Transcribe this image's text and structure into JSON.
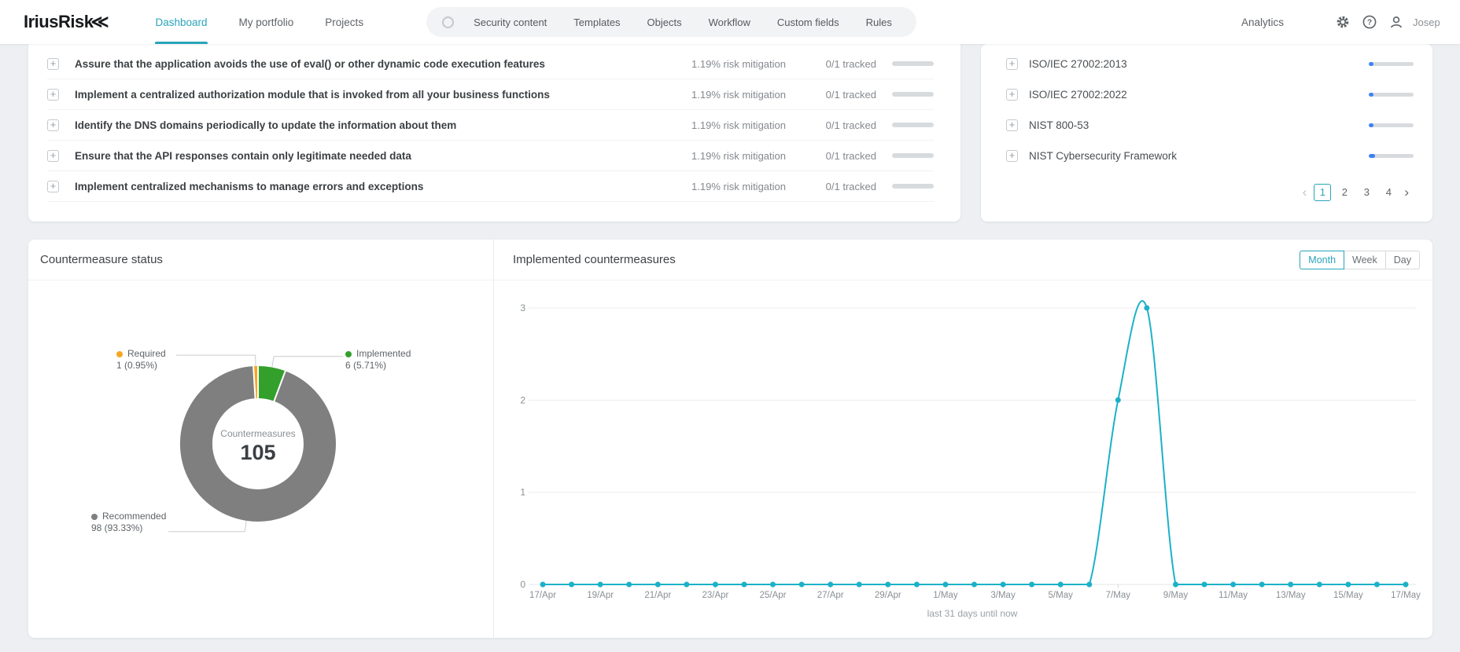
{
  "colors": {
    "accent": "#2aa4ba",
    "line": "#1cb1c8",
    "progress_blue": "#3b82f6",
    "progress_track": "#d8dbde"
  },
  "nav": {
    "logo": "IriusRisk",
    "tabs": [
      {
        "label": "Dashboard",
        "active": true
      },
      {
        "label": "My portfolio",
        "active": false
      },
      {
        "label": "Projects",
        "active": false
      }
    ],
    "pill": {
      "items": [
        "Security content",
        "Templates",
        "Objects",
        "Workflow",
        "Custom fields",
        "Rules"
      ]
    },
    "right": {
      "analytics_label": "Analytics",
      "username": "Josep"
    }
  },
  "countermeasures_panel": {
    "rows": [
      {
        "title": "Assure that the application avoids the use of eval() or other dynamic code execution features",
        "mitigation": "1.19% risk mitigation",
        "tracked": "0/1 tracked",
        "progress_pct": 0
      },
      {
        "title": "Implement a centralized authorization module that is invoked from all your business functions",
        "mitigation": "1.19% risk mitigation",
        "tracked": "0/1 tracked",
        "progress_pct": 0
      },
      {
        "title": "Identify the DNS domains periodically to update the information about them",
        "mitigation": "1.19% risk mitigation",
        "tracked": "0/1 tracked",
        "progress_pct": 0
      },
      {
        "title": "Ensure that the API responses contain only legitimate needed data",
        "mitigation": "1.19% risk mitigation",
        "tracked": "0/1 tracked",
        "progress_pct": 0
      },
      {
        "title": "Implement centralized mechanisms to manage errors and exceptions",
        "mitigation": "1.19% risk mitigation",
        "tracked": "0/1 tracked",
        "progress_pct": 0
      }
    ]
  },
  "standards_panel": {
    "rows": [
      {
        "title": "ISO/IEC 27002:2013",
        "progress_pct": 10
      },
      {
        "title": "ISO/IEC 27002:2022",
        "progress_pct": 10
      },
      {
        "title": "NIST 800-53",
        "progress_pct": 10
      },
      {
        "title": "NIST Cybersecurity Framework",
        "progress_pct": 14
      }
    ],
    "pagination": {
      "pages": [
        "1",
        "2",
        "3",
        "4"
      ],
      "active_page": "1"
    }
  },
  "status_panel": {
    "title": "Countermeasure status"
  },
  "implemented_panel": {
    "title": "Implemented countermeasures",
    "range_options": [
      {
        "label": "Month",
        "active": true
      },
      {
        "label": "Week",
        "active": false
      },
      {
        "label": "Day",
        "active": false
      }
    ]
  },
  "chart_data": [
    {
      "type": "pie",
      "title": "Countermeasure status",
      "donut": true,
      "center_label": "Countermeasures",
      "center_value": "105",
      "total": 105,
      "slices": [
        {
          "name": "Implemented",
          "value": 6,
          "pct": "5.71%",
          "label_line1": "Implemented",
          "label_line2": "6 (5.71%)",
          "color": "#33a02c"
        },
        {
          "name": "Recommended",
          "value": 98,
          "pct": "93.33%",
          "label_line1": "Recommended",
          "label_line2": "98 (93.33%)",
          "color": "#7f7f7f"
        },
        {
          "name": "Required",
          "value": 1,
          "pct": "0.95%",
          "label_line1": "Required",
          "label_line2": "1 (0.95%)",
          "color": "#f5a623"
        }
      ]
    },
    {
      "type": "line",
      "series_name": "Implemented countermeasures",
      "smooth": true,
      "color": "#1cb1c8",
      "x": [
        "17/Apr",
        "18/Apr",
        "19/Apr",
        "20/Apr",
        "21/Apr",
        "22/Apr",
        "23/Apr",
        "24/Apr",
        "25/Apr",
        "26/Apr",
        "27/Apr",
        "28/Apr",
        "29/Apr",
        "30/Apr",
        "1/May",
        "2/May",
        "3/May",
        "4/May",
        "5/May",
        "6/May",
        "7/May",
        "8/May",
        "9/May",
        "10/May",
        "11/May",
        "12/May",
        "13/May",
        "14/May",
        "15/May",
        "16/May",
        "17/May"
      ],
      "values": [
        0,
        0,
        0,
        0,
        0,
        0,
        0,
        0,
        0,
        0,
        0,
        0,
        0,
        0,
        0,
        0,
        0,
        0,
        0,
        0,
        2,
        3,
        0,
        0,
        0,
        0,
        0,
        0,
        0,
        0,
        0
      ],
      "tick_every": 2,
      "x_tick_labels": [
        "17/Apr",
        "19/Apr",
        "21/Apr",
        "23/Apr",
        "25/Apr",
        "27/Apr",
        "29/Apr",
        "1/May",
        "3/May",
        "5/May",
        "7/May",
        "9/May",
        "11/May",
        "13/May",
        "15/May",
        "17/May"
      ],
      "yticks": [
        0,
        1,
        2,
        3
      ],
      "ylim": [
        0,
        3
      ],
      "grid": true,
      "caption": "last 31 days until now"
    }
  ]
}
